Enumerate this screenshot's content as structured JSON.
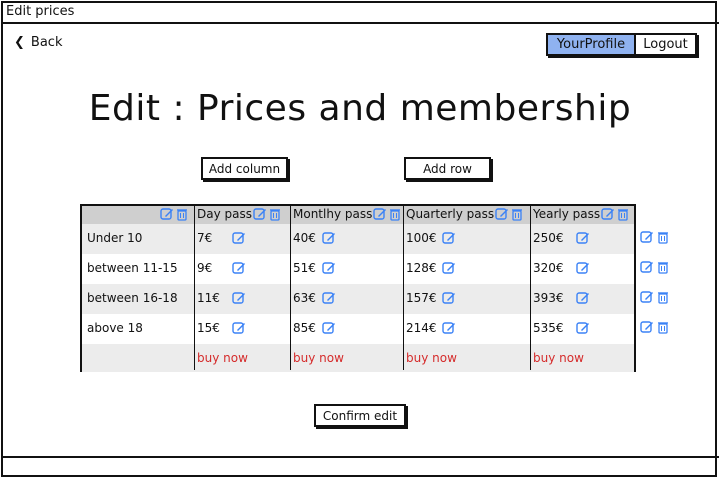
{
  "window": {
    "title": "Edit prices"
  },
  "nav": {
    "back_label": "Back",
    "profile_label": "YourProfile",
    "logout_label": "Logout"
  },
  "page": {
    "heading": "Edit : Prices and membership"
  },
  "actions": {
    "add_column": "Add column",
    "add_row": "Add row",
    "confirm": "Confirm edit"
  },
  "table": {
    "columns": [
      "Day pass",
      "Montlhy pass",
      "Quarterly pass",
      "Yearly pass"
    ],
    "rows": [
      {
        "label": "Under 10",
        "values": [
          "7€",
          "40€",
          "100€",
          "250€"
        ]
      },
      {
        "label": "between 11-15",
        "values": [
          "9€",
          "51€",
          "128€",
          "320€"
        ]
      },
      {
        "label": "between 16-18",
        "values": [
          "11€",
          "63€",
          "157€",
          "393€"
        ]
      },
      {
        "label": "above 18",
        "values": [
          "15€",
          "85€",
          "214€",
          "535€"
        ]
      }
    ],
    "buy_label": "buy now"
  },
  "colors": {
    "accent": "#3b82f6",
    "link": "#d52b2b",
    "selected_tab": "#8fb2f0",
    "header_bg": "#cfcfcf",
    "stripe": "#ececec"
  },
  "icons": {
    "edit": "edit-icon",
    "delete": "trash-icon",
    "back": "chevron-left-icon"
  }
}
